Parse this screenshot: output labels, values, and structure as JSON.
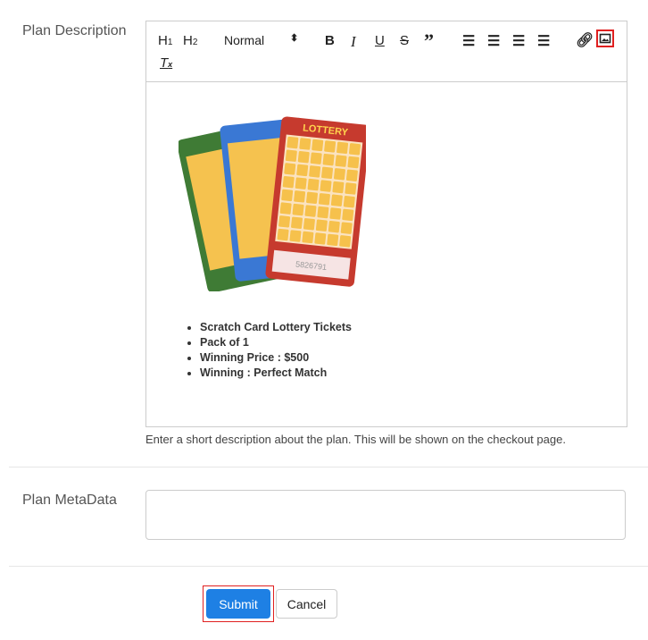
{
  "description": {
    "label": "Plan Description",
    "toolbar": {
      "h1": "H1",
      "h2": "H2",
      "format_select": "Normal",
      "icons": [
        "h1-icon",
        "h2-icon",
        "bold-icon",
        "italic-icon",
        "underline-icon",
        "strike-icon",
        "blockquote-icon",
        "ordered-list-icon",
        "bullet-list-icon",
        "outdent-icon",
        "indent-icon",
        "link-icon",
        "image-icon",
        "clear-format-icon"
      ],
      "highlight_color": "#e02020"
    },
    "image": {
      "card_title": "LOTTERY",
      "ticket_number": "5826791"
    },
    "bullets": [
      "Scratch Card Lottery Tickets",
      "Pack of 1",
      "Winning Price : $500",
      "Winning : Perfect Match"
    ],
    "help": "Enter a short description about the plan. This will be shown on the checkout page."
  },
  "metadata": {
    "label": "Plan MetaData",
    "value": ""
  },
  "actions": {
    "submit": "Submit",
    "cancel": "Cancel",
    "submit_color": "#1e80e4"
  }
}
